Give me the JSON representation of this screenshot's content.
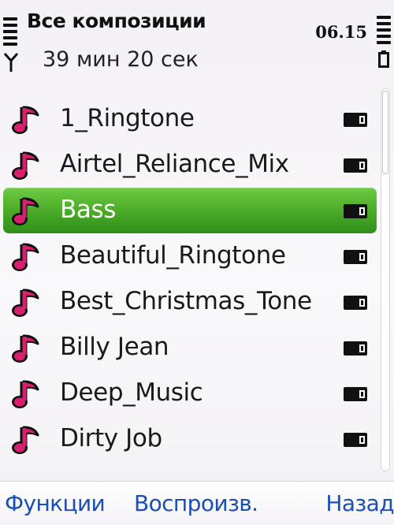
{
  "header": {
    "title": "Все композиции",
    "subtitle": "39 мин 20 сек",
    "clock": "06.15"
  },
  "tracks": [
    {
      "label": "1_Ringtone",
      "selected": false
    },
    {
      "label": "Airtel_Reliance_Mix",
      "selected": false
    },
    {
      "label": "Bass",
      "selected": true
    },
    {
      "label": "Beautiful_Ringtone",
      "selected": false
    },
    {
      "label": "Best_Christmas_Tone",
      "selected": false
    },
    {
      "label": "Billy Jean",
      "selected": false
    },
    {
      "label": "Deep_Music",
      "selected": false
    },
    {
      "label": "Dirty Job",
      "selected": false
    }
  ],
  "icons": {
    "track": "music-note-icon",
    "storage": "memory-card-icon"
  },
  "softkeys": {
    "left": "Функции",
    "middle": "Воспроизв.",
    "right": "Назад"
  },
  "colors": {
    "note": "#d8206e",
    "selection": "#4fae2b",
    "softkey": "#1a4fb5"
  }
}
